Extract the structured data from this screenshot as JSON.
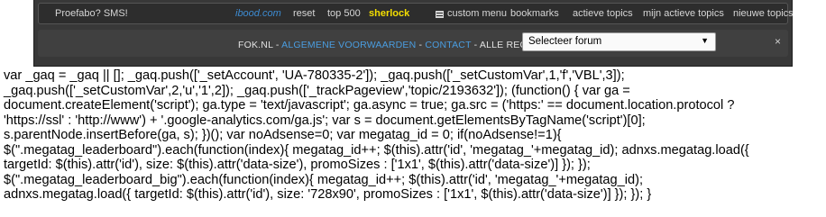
{
  "topbar": {
    "proefabo": "Proefabo? SMS!",
    "ibood": "ibood.com",
    "reset": "reset",
    "top500": "top 500",
    "sherlock": "sherlock",
    "custom_menu": "custom menu",
    "bookmarks": "bookmarks",
    "actieve_topics": "actieve topics",
    "mijn_actieve_topics": "mijn actieve topics",
    "nieuwe_topics": "nieuwe topics"
  },
  "footer": {
    "site": "FOK.NL",
    "sep1": " - ",
    "voorwaarden": "ALGEMENE VOORWAARDEN",
    "sep2": " - ",
    "contact": "CONTACT",
    "rights": " - ALLE RECHTEN VOORBEHOUDEN",
    "forum_select": "Selecteer forum",
    "close": "×"
  },
  "code_lines": [
    "var _gaq = _gaq || []; _gaq.push(['_setAccount', 'UA-780335-2']); _gaq.push(['_setCustomVar',1,'f','VBL',3]);",
    "_gaq.push(['_setCustomVar',2,'u','1',2]); _gaq.push(['_trackPageview','topic/2193632']); (function() { var ga =",
    "document.createElement('script'); ga.type = 'text/javascript'; ga.async = true; ga.src = ('https:' == document.location.protocol ?",
    "'https://ssl' : 'http://www') + '.google-analytics.com/ga.js'; var s = document.getElementsByTagName('script')[0];",
    "s.parentNode.insertBefore(ga, s); })(); var noAdsense=0; var megatag_id = 0; if(noAdsense!=1){",
    "$(\".megatag_leaderboard\").each(function(index){ megatag_id++; $(this).attr('id', 'megatag_'+megatag_id); adnxs.megatag.load({",
    "targetId: $(this).attr('id'), size: $(this).attr('data-size'), promoSizes : ['1x1', $(this).attr('data-size')] }); });",
    "$(\".megatag_leaderboard_big\").each(function(index){ megatag_id++; $(this).attr('id', 'megatag_'+megatag_id);",
    "adnxs.megatag.load({ targetId: $(this).attr('id'), size: '728x90', promoSizes : ['1x1', $(this).attr('data-size')] }); }); }"
  ]
}
